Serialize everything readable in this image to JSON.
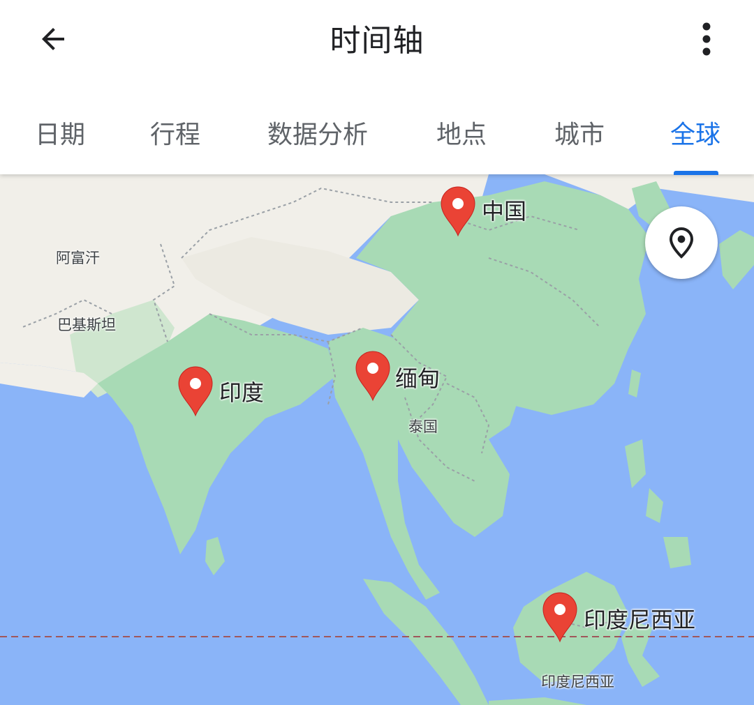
{
  "header": {
    "title": "时间轴",
    "back_icon": "arrow-back-icon",
    "more_icon": "more-vert-icon"
  },
  "tabs": [
    {
      "label": "日期",
      "active": false
    },
    {
      "label": "行程",
      "active": false
    },
    {
      "label": "数据分析",
      "active": false
    },
    {
      "label": "地点",
      "active": false
    },
    {
      "label": "城市",
      "active": false
    },
    {
      "label": "全球",
      "active": true
    }
  ],
  "colors": {
    "accent": "#1a73e8",
    "marker": "#ea4335",
    "water": "#8ab4f8",
    "land_green": "#a8dab5",
    "land_arid": "#f1efe9"
  },
  "map": {
    "base_labels": {
      "afghanistan": "阿富汗",
      "pakistan": "巴基斯坦",
      "thailand": "泰国",
      "indonesia": "印度尼西亚"
    },
    "markers": {
      "china": "中国",
      "india": "印度",
      "myanmar": "缅甸",
      "indonesia": "印度尼西亚"
    },
    "locate_icon": "location-pin-icon"
  }
}
